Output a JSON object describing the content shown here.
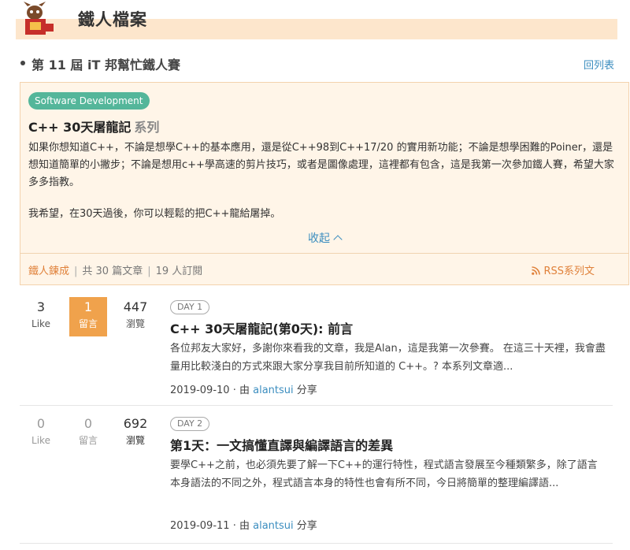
{
  "header": {
    "title": "鐵人檔案"
  },
  "contest": {
    "title": "第 11 屆 iT 邦幫忙鐵人賽",
    "back_link": "回列表"
  },
  "series": {
    "tag": "Software Development",
    "title": "C++ 30天屠龍記",
    "title_suffix": "系列",
    "description_p1": "如果你想知道C++，不論是想學C++的基本應用，還是從C++98到C++17/20 的實用新功能；不論是想學困難的Poiner，還是想知道簡單的小撇步；不論是想用c++學高速的剪片技巧，或者是圖像處理，這裡都有包含，這是我第一次參加鐵人賽，希望大家多多指教。",
    "description_p2": "我希望，在30天過後，你可以輕鬆的把C++龍給屠掉。",
    "collapse_label": "收起",
    "footer_category": "鐵人鍊成",
    "footer_articles": "共 30 篇文章",
    "footer_subscribers": "19 人訂閱",
    "rss_label": "RSS系列文"
  },
  "articles": [
    {
      "likes": "3",
      "likes_label": "Like",
      "replies": "1",
      "replies_label": "留言",
      "views": "447",
      "views_label": "瀏覽",
      "day": "DAY 1",
      "title": "C++ 30天屠龍記(第0天): 前言",
      "excerpt": "各位邦友大家好，多謝你來看我的文章，我是Alan，這是我第一次參賽。 在這三十天裡，我會盡量用比較淺白的方式來跟大家分享我目前所知道的 C++。? 本系列文章適...",
      "date": "2019-09-10",
      "by": "由",
      "author": "alantsui",
      "share": "分享"
    },
    {
      "likes": "0",
      "likes_label": "Like",
      "replies": "0",
      "replies_label": "留言",
      "views": "692",
      "views_label": "瀏覽",
      "day": "DAY 2",
      "title": "第1天：一文搞懂直譯與編譯語言的差異",
      "excerpt": "要學C++之前，也必須先要了解一下C++的運行特性，程式語言發展至今種類繁多，除了語言本身語法的不同之外，程式語言本身的特性也會有所不同，今日將簡單的整理編譯語...",
      "date": "2019-09-11",
      "by": "由",
      "author": "alantsui",
      "share": "分享"
    }
  ],
  "colors": {
    "accent_orange": "#f0a24c",
    "header_band": "#fde6cc",
    "tag_green": "#54b69a",
    "link_blue": "#3b8dbf",
    "series_bg": "#fff5e8"
  }
}
